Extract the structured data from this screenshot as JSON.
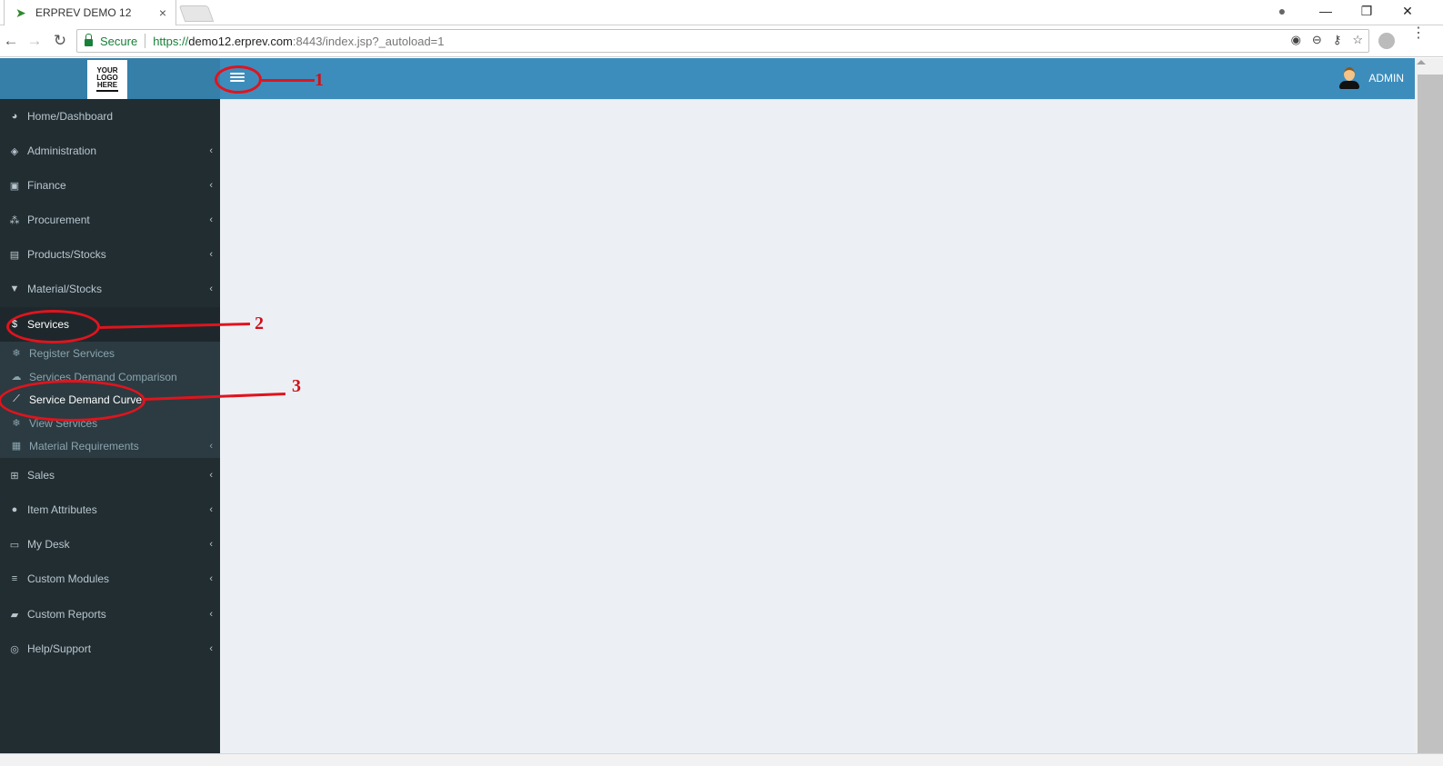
{
  "browser": {
    "tab_title": "ERPREV DEMO 12",
    "tab_close": "×",
    "secure_label": "Secure",
    "url_scheme": "https://",
    "url_host": "demo12.erprev.com",
    "url_rest": ":8443/index.jsp?_autoload=1",
    "nav": {
      "back": "←",
      "forward": "→",
      "reload": "↻"
    },
    "window": {
      "minimize": "—",
      "restore": "❐",
      "close": "✕",
      "profile": "●"
    },
    "omni_icons": {
      "location": "◉",
      "zoom": "⊖",
      "key": "⚷",
      "bookmark": "☆"
    },
    "menu": "⋮"
  },
  "header": {
    "logo_lines": [
      "YOUR",
      "LOGO",
      "HERE"
    ],
    "user_name": "ADMIN",
    "theme_color": "#3c8dbc"
  },
  "sidebar": {
    "items": [
      {
        "label": "Home/Dashboard",
        "icon": "dashboard-icon",
        "glyph": "◕",
        "chevron": ""
      },
      {
        "label": "Administration",
        "icon": "tag-icon",
        "glyph": "◈",
        "chevron": "‹"
      },
      {
        "label": "Finance",
        "icon": "money-icon",
        "glyph": "▣",
        "chevron": "‹"
      },
      {
        "label": "Procurement",
        "icon": "cubes-icon",
        "glyph": "⁂",
        "chevron": "‹"
      },
      {
        "label": "Products/Stocks",
        "icon": "building-icon",
        "glyph": "▤",
        "chevron": "‹"
      },
      {
        "label": "Material/Stocks",
        "icon": "trash-icon",
        "glyph": "▼",
        "chevron": "‹"
      },
      {
        "label": "Services",
        "icon": "dollar-icon",
        "glyph": "$",
        "chevron": ""
      },
      {
        "label": "Sales",
        "icon": "cart-icon",
        "glyph": "⊞",
        "chevron": "‹"
      },
      {
        "label": "Item Attributes",
        "icon": "badge-icon",
        "glyph": "●",
        "chevron": "‹"
      },
      {
        "label": "My Desk",
        "icon": "desktop-icon",
        "glyph": "▭",
        "chevron": "‹"
      },
      {
        "label": "Custom Modules",
        "icon": "database-icon",
        "glyph": "≡",
        "chevron": "‹"
      },
      {
        "label": "Custom Reports",
        "icon": "book-icon",
        "glyph": "▰",
        "chevron": "‹"
      },
      {
        "label": "Help/Support",
        "icon": "life-ring-icon",
        "glyph": "◎",
        "chevron": "‹"
      }
    ],
    "services_submenu": [
      {
        "label": "Register Services",
        "icon": "snowflake-icon",
        "glyph": "❄",
        "chevron": ""
      },
      {
        "label": "Services Demand Comparison",
        "icon": "cloud-chart-icon",
        "glyph": "☁",
        "chevron": ""
      },
      {
        "label": "Service Demand Curve",
        "icon": "line-chart-icon",
        "glyph": "⟋",
        "chevron": ""
      },
      {
        "label": "View Services",
        "icon": "snowflake-icon",
        "glyph": "❄",
        "chevron": ""
      },
      {
        "label": "Material Requirements",
        "icon": "gift-icon",
        "glyph": "▦",
        "chevron": "‹"
      }
    ]
  },
  "annotations": [
    "1",
    "2",
    "3"
  ]
}
